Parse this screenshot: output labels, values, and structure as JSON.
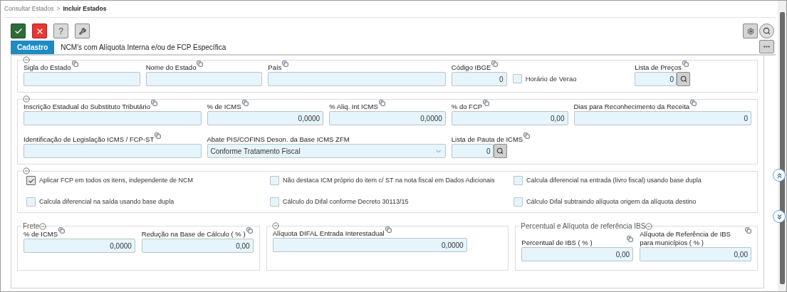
{
  "breadcrumb": [
    {
      "label": "Consultar Estados",
      "current": false
    },
    {
      "label": "Incluir Estados",
      "current": true
    }
  ],
  "breadcrumb_separator": ">",
  "toolbar": {
    "buttons": [
      {
        "kind": "confirm"
      },
      {
        "kind": "cancel"
      },
      {
        "kind": "help",
        "label": "?"
      },
      {
        "kind": "tools"
      }
    ],
    "right_buttons": [
      {
        "kind": "settings"
      },
      {
        "kind": "search"
      }
    ]
  },
  "tabs": [
    {
      "label": "Cadastro",
      "selected": true
    },
    {
      "label": "NCM's com Alíquota Interna e/ou de FCP Específica",
      "selected": false
    }
  ],
  "sections": [
    {
      "items": [
        {
          "kind": "text",
          "label": "Sigla do Estado",
          "copyable": true
        },
        {
          "kind": "text",
          "label": "Nome do Estado",
          "copyable": true
        },
        {
          "kind": "text",
          "label": "País",
          "copyable": true
        },
        {
          "kind": "number",
          "label": "Código IBGE",
          "copyable": true,
          "value": "0"
        },
        {
          "kind": "checkbox",
          "label": "Horário de Verao",
          "checked": false
        },
        {
          "kind": "lookup",
          "label": "Lista de Preços",
          "copyable": true,
          "value": "0"
        }
      ]
    },
    {
      "items": [
        {
          "kind": "text",
          "label": "Inscrição Estadual do Substituto Tributário",
          "copyable": true
        },
        {
          "kind": "number",
          "label": "% de ICMS",
          "copyable": true,
          "value": "0,0000"
        },
        {
          "kind": "number",
          "label": "% Aliq. Int ICMS",
          "copyable": true,
          "value": "0,0000"
        },
        {
          "kind": "number",
          "label": "% do FCP",
          "copyable": true,
          "value": "0,00"
        },
        {
          "kind": "number",
          "label": "Dias para Reconhecimento da Receita",
          "copyable": true,
          "value": "0"
        },
        {
          "kind": "text",
          "label": "Identificação de Legislação ICMS / FCP-ST",
          "copyable": true
        },
        {
          "kind": "select",
          "label": "Abate PIS/COFINS Deson. da Base ICMS ZFM",
          "copyable": false,
          "value": "Conforme Tratamento Fiscal"
        },
        {
          "kind": "lookup",
          "label": "Lista de Pauta de ICMS",
          "copyable": true,
          "value": "0"
        }
      ]
    },
    {
      "items": [
        {
          "kind": "checkbox",
          "label": "Aplicar FCP em todos os itens, independente de NCM",
          "checked": true
        },
        {
          "kind": "checkbox",
          "label": "Não destaca ICM próprio do item c/ ST na nota fiscal em Dados Adicionais",
          "checked": false
        },
        {
          "kind": "checkbox",
          "label": "Calcula diferencial na entrada (livro fiscal) usando base dupla",
          "checked": false
        },
        {
          "kind": "checkbox",
          "label": "Calcula diferencial na saída usando base dupla",
          "checked": false
        },
        {
          "kind": "checkbox",
          "label": "Cálculo do Difal conforme Decreto 30113/15",
          "checked": false
        },
        {
          "kind": "checkbox",
          "label": "Cálculo Difal subtraindo alíquota origem da alíquota destino",
          "checked": false
        }
      ]
    }
  ],
  "groups": [
    {
      "legend": "Frete",
      "items": [
        {
          "kind": "number",
          "label": "% de ICMS",
          "copyable": true,
          "value": "0,0000"
        },
        {
          "kind": "number",
          "label": "Redução na Base de Cálculo ( % )",
          "copyable": true,
          "value": "0,00"
        }
      ]
    },
    {
      "items": [
        {
          "kind": "number",
          "label": "Alíquota DIFAL Entrada Interestadual",
          "copyable": true,
          "value": "0,0000"
        }
      ]
    },
    {
      "legend": "Percentual e Alíquota de referência IBS",
      "items": [
        {
          "kind": "number",
          "label": "Percentual de IBS ( % )",
          "copyable": true,
          "value": "0,00"
        },
        {
          "kind": "number",
          "label": "Alíquota de Referência de IBS para municípios ( % )",
          "copyable": true,
          "value": "0,00"
        }
      ]
    }
  ]
}
